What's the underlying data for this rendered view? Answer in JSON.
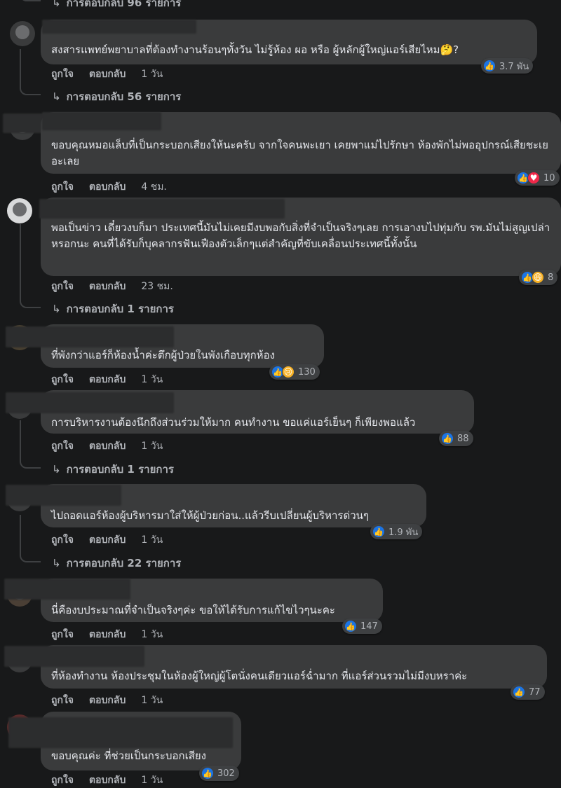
{
  "actions": {
    "like": "ถูกใจ",
    "reply": "ตอบกลับ"
  },
  "top_replies": "การตอบกลับ 96 รายการ",
  "comments": [
    {
      "text": "สงสารแพทย์พยาบาลที่ต้องทำงานร้อนๆทั้งวัน ไม่รู้ห้อง ผอ หรือ ผู้หลักผู้ใหญ่แอร์เสียไหม🤔?",
      "time": "1 วัน",
      "reactions": "3.7 พัน",
      "replies": "การตอบกลับ 56 รายการ"
    },
    {
      "text": "ขอบคุณหมอแล็บที่เป็นกระบอกเสียงให้นะครับ จากใจคนพะเยา เคยพาแม่ไปรักษา ห้องพักไม่พออุปกรณ์เสียชะเยอะเลย",
      "time": "4 ชม.",
      "reactions": "10"
    },
    {
      "text": "พอเป็นข่าว เดี๋ยวงบก็มา ประเทศนี้มันไม่เคยมีงบพอกับสิ่งที่จำเป็นจริงๆเลย การเอางบไปทุ่มกับ รพ.มันไม่สูญเปล่าหรอกนะ คนที่ได้รับก็บุคลากรฟันเฟืองตัวเล็กๆแต่สำคัญที่ขับเคลื่อนประเทศนี้ทั้งนั้น",
      "time": "23 ชม.",
      "reactions": "8",
      "replies": "การตอบกลับ 1 รายการ"
    },
    {
      "text": "ที่พังกว่าแอร์ก็ห้องน้ำค่ะตึกผู้ป่วยในพังเกือบทุกห้อง",
      "time": "1 วัน",
      "reactions": "130"
    },
    {
      "text": "การบริหารงานต้องนึกถึงส่วนร่วมให้มาก คนทำงาน ขอแค่แอร์เย็นๆ ก็เพียงพอแล้ว",
      "time": "1 วัน",
      "reactions": "88",
      "replies": "การตอบกลับ 1 รายการ"
    },
    {
      "text": "ไปถอดแอร์ห้องผู้บริหารมาใส่ให้ผู้ป่วยก่อน..แล้วรีบเปลี่ยนผู้บริหารด่วนๆ",
      "time": "1 วัน",
      "reactions": "1.9 พัน",
      "replies": "การตอบกลับ 22 รายการ"
    },
    {
      "text": "นี่คืองบประมาณที่จำเป็นจริงๆค่ะ ขอให้ได้รับการแก้ไขไวๆนะคะ",
      "time": "1 วัน",
      "reactions": "147"
    },
    {
      "text": "ที่ห้องทำงาน ห้องประชุมในห้องผู้ใหญ่ผู้โตนั่งคนเดียวแอร์ฉ่ำมาก ที่แอร์ส่วนรวมไม่มีงบหราค่ะ",
      "time": "1 วัน",
      "reactions": "77"
    },
    {
      "text": "ขอบคุณค่ะ ที่ช่วยเป็นกระบอกเสียง",
      "time": "1 วัน",
      "reactions": "302"
    }
  ],
  "colors": {
    "background": "#18191a",
    "bubble": "#3a3b3c",
    "like": "#1b74e4",
    "love": "#f02849",
    "emoji": "#f7b125"
  },
  "icons": [
    "like-icon",
    "love-icon",
    "haha-icon",
    "sad-icon",
    "reply-arrow-icon"
  ]
}
